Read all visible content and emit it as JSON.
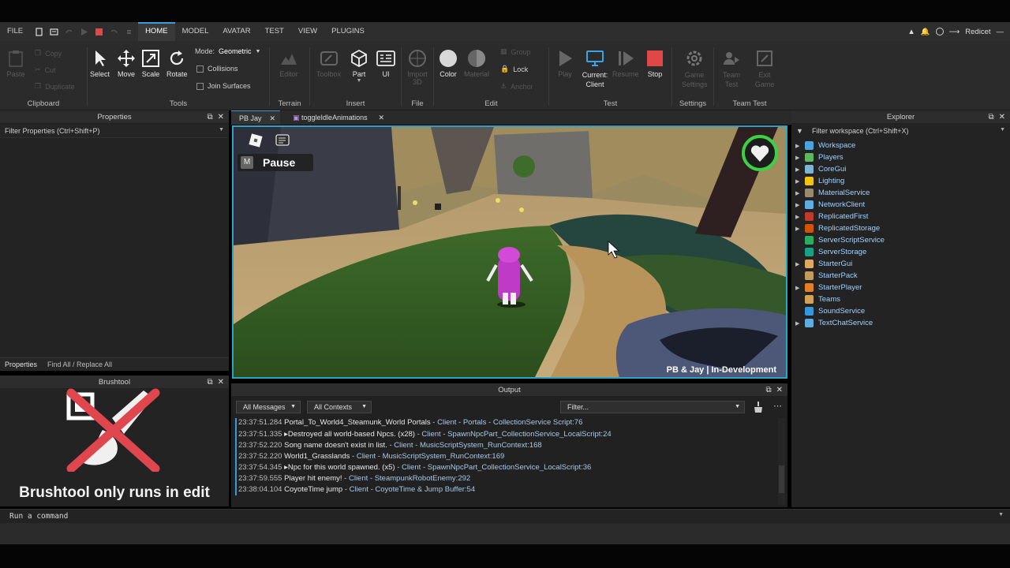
{
  "menu": {
    "tabs": [
      "FILE",
      "HOME",
      "MODEL",
      "AVATAR",
      "TEST",
      "VIEW",
      "PLUGINS"
    ],
    "active": "HOME",
    "user": "Redicet"
  },
  "ribbon": {
    "clipboard": {
      "label": "Clipboard",
      "paste": "Paste",
      "copy": "Copy",
      "cut": "Cut",
      "duplicate": "Duplicate"
    },
    "tools": {
      "label": "Tools",
      "select": "Select",
      "move": "Move",
      "scale": "Scale",
      "rotate": "Rotate",
      "mode_label": "Mode:",
      "mode_value": "Geometric",
      "collisions": "Collisions",
      "join_surfaces": "Join Surfaces"
    },
    "terrain": {
      "label": "Terrain",
      "editor": "Editor"
    },
    "insert": {
      "label": "Insert",
      "toolbox": "Toolbox",
      "part": "Part",
      "ui": "UI"
    },
    "file": {
      "label": "File",
      "import3d": "Import 3D"
    },
    "edit": {
      "label": "Edit",
      "color": "Color",
      "material": "Material",
      "group": "Group",
      "lock": "Lock",
      "anchor": "Anchor"
    },
    "test": {
      "label": "Test",
      "play": "Play",
      "current_client": "Current: Client",
      "resume": "Resume",
      "stop": "Stop"
    },
    "settings": {
      "label": "Settings",
      "game_settings": "Game Settings"
    },
    "team_test": {
      "label": "Team Test",
      "team_test": "Team Test",
      "exit_game": "Exit Game"
    }
  },
  "properties": {
    "title": "Properties",
    "filter_placeholder": "Filter Properties (Ctrl+Shift+P)",
    "bottom_tabs": [
      "Properties",
      "Find All / Replace All"
    ]
  },
  "brushtool": {
    "title": "Brushtool",
    "message": "Brushtool only runs in edit"
  },
  "doc_tabs": [
    "PB Jay",
    "toggleIdleAnimations"
  ],
  "viewport": {
    "pause_key": "M",
    "pause_label": "Pause",
    "watermark": "PB & Jay | In-Development"
  },
  "output": {
    "title": "Output",
    "messages_filter": "All Messages",
    "contexts_filter": "All Contexts",
    "filter_placeholder": "Filter...",
    "lines": [
      {
        "ts": "23:37:51.284",
        "msg": "Portal_To_World4_Steamunk_World Portals",
        "src": "- Client - Portals - CollectionService Script:76"
      },
      {
        "ts": "23:37:51.335",
        "msg": "▸Destroyed all world-based Npcs. (x28)",
        "src": "- Client - SpawnNpcPart_CollectionService_LocalScript:24"
      },
      {
        "ts": "23:37:52.220",
        "msg": "Song name doesn't exist in list.",
        "src": "- Client - MusicScriptSystem_RunContext:168"
      },
      {
        "ts": "23:37:52.220",
        "msg": "World1_Grasslands",
        "src": "- Client - MusicScriptSystem_RunContext:169"
      },
      {
        "ts": "23:37:54.345",
        "msg": "▸Npc for this world spawned. (x5)",
        "src": "- Client - SpawnNpcPart_CollectionService_LocalScript:36"
      },
      {
        "ts": "23:37:59.555",
        "msg": "Player hit enemy!",
        "src": "- Client - SteampunkRobotEnemy:292"
      },
      {
        "ts": "23:38:04.104",
        "msg": "CoyoteTime jump",
        "src": "- Client - CoyoteTime & Jump Buffer:54"
      }
    ]
  },
  "explorer": {
    "title": "Explorer",
    "filter_placeholder": "Filter workspace (Ctrl+Shift+X)",
    "items": [
      {
        "label": "Workspace",
        "color": "#4aa3df",
        "arrow": true
      },
      {
        "label": "Players",
        "color": "#5cb85c",
        "arrow": true
      },
      {
        "label": "CoreGui",
        "color": "#7fb3d5",
        "arrow": true
      },
      {
        "label": "Lighting",
        "color": "#f1c40f",
        "arrow": true
      },
      {
        "label": "MaterialService",
        "color": "#9b8b6e",
        "arrow": true
      },
      {
        "label": "NetworkClient",
        "color": "#5dade2",
        "arrow": true
      },
      {
        "label": "ReplicatedFirst",
        "color": "#c0392b",
        "arrow": true
      },
      {
        "label": "ReplicatedStorage",
        "color": "#d35400",
        "arrow": true
      },
      {
        "label": "ServerScriptService",
        "color": "#27ae60",
        "arrow": false
      },
      {
        "label": "ServerStorage",
        "color": "#16a085",
        "arrow": false
      },
      {
        "label": "StarterGui",
        "color": "#e0a75e",
        "arrow": true
      },
      {
        "label": "StarterPack",
        "color": "#c49a5a",
        "arrow": false
      },
      {
        "label": "StarterPlayer",
        "color": "#e67e22",
        "arrow": true
      },
      {
        "label": "Teams",
        "color": "#d4a256",
        "arrow": false
      },
      {
        "label": "SoundService",
        "color": "#3498db",
        "arrow": false
      },
      {
        "label": "TextChatService",
        "color": "#5dade2",
        "arrow": true
      }
    ]
  },
  "command_bar": {
    "placeholder": "Run a command"
  }
}
